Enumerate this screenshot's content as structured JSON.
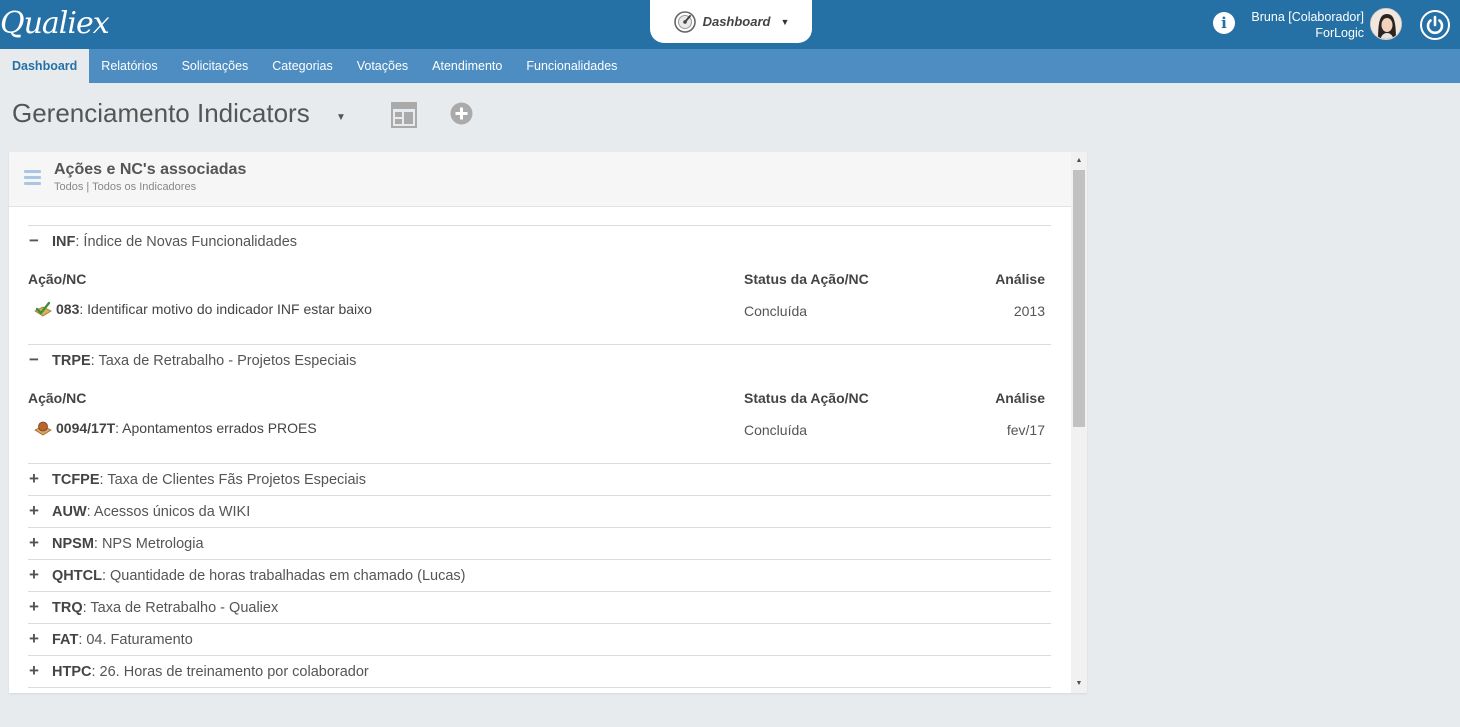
{
  "app": {
    "logo": "Qualiex",
    "dashboard_selector": "Dashboard",
    "user_name": "Bruna [Colaborador]",
    "company": "ForLogic"
  },
  "nav": {
    "items": [
      "Dashboard",
      "Relatórios",
      "Solicitações",
      "Categorias",
      "Votações",
      "Atendimento",
      "Funcionalidades"
    ],
    "active": "Dashboard"
  },
  "page": {
    "title": "Gerenciamento Indicators"
  },
  "widget": {
    "title": "Ações e NC's associadas",
    "subtitle": "Todos | Todos os Indicadores",
    "columns": {
      "action": "Ação/NC",
      "status": "Status da Ação/NC",
      "analysis": "Análise"
    },
    "indicators": [
      {
        "code": "INF",
        "name": ": Índice de Novas Funcionalidades",
        "toggle": "−",
        "action_num": "083",
        "action_desc": ": Identificar motivo do indicador INF estar baixo",
        "status": "Concluída",
        "analysis": "2013"
      },
      {
        "code": "TRPE",
        "name": ": Taxa de Retrabalho - Projetos Especiais",
        "toggle": "−",
        "action_num": "0094/17T",
        "action_desc": ": Apontamentos errados PROES",
        "status": "Concluída",
        "analysis": "fev/17"
      },
      {
        "code": "TCFPE",
        "name": ": Taxa de Clientes Fãs Projetos Especiais",
        "toggle": "+"
      },
      {
        "code": "AUW",
        "name": ": Acessos únicos da WIKI",
        "toggle": "+"
      },
      {
        "code": "NPSM",
        "name": ": NPS Metrologia",
        "toggle": "+"
      },
      {
        "code": "QHTCL",
        "name": ": Quantidade de horas trabalhadas em chamado (Lucas)",
        "toggle": "+"
      },
      {
        "code": "TRQ",
        "name": ": Taxa de Retrabalho - Qualiex",
        "toggle": "+"
      },
      {
        "code": "FAT",
        "name": ": 04. Faturamento",
        "toggle": "+"
      },
      {
        "code": "HTPC",
        "name": ": 26. Horas de treinamento por colaborador",
        "toggle": "+"
      }
    ]
  }
}
